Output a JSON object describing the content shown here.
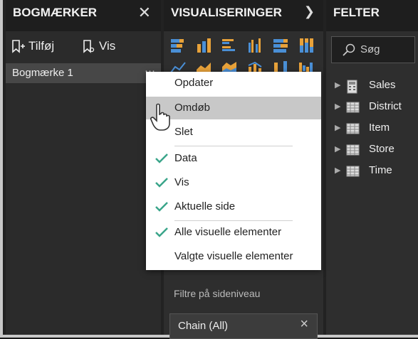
{
  "bookmarks": {
    "title": "BOGMÆRKER",
    "add_label": "Tilføj",
    "view_label": "Vis",
    "item_label": "Bogmærke 1",
    "item_more": "···"
  },
  "visualizations": {
    "title": "VISUALISERINGER",
    "page_filters_label": "Filtre på sideniveau",
    "filter_chip_label": "Chain  (All)"
  },
  "filters": {
    "title": "FELTER",
    "search_placeholder": "Søg",
    "items": [
      {
        "label": "Sales",
        "icon": "calculator-icon"
      },
      {
        "label": "District",
        "icon": "table-icon"
      },
      {
        "label": "Item",
        "icon": "table-icon"
      },
      {
        "label": "Store",
        "icon": "table-icon"
      },
      {
        "label": "Time",
        "icon": "table-icon"
      }
    ]
  },
  "context_menu": {
    "items": [
      {
        "label": "Opdater",
        "checked": false
      },
      {
        "label": "Omdøb",
        "checked": false,
        "highlighted": true
      },
      {
        "label": "Slet",
        "checked": false
      },
      {
        "label": "Data",
        "checked": true
      },
      {
        "label": "Vis",
        "checked": true
      },
      {
        "label": "Aktuelle side",
        "checked": true
      },
      {
        "label": "Alle visuelle elementer",
        "checked": true
      },
      {
        "label": "Valgte visuelle elementer",
        "checked": false
      }
    ]
  },
  "colors": {
    "accent_check": "#3aa58a",
    "viz_orange": "#e8a23a",
    "viz_blue": "#4a8fd6"
  }
}
